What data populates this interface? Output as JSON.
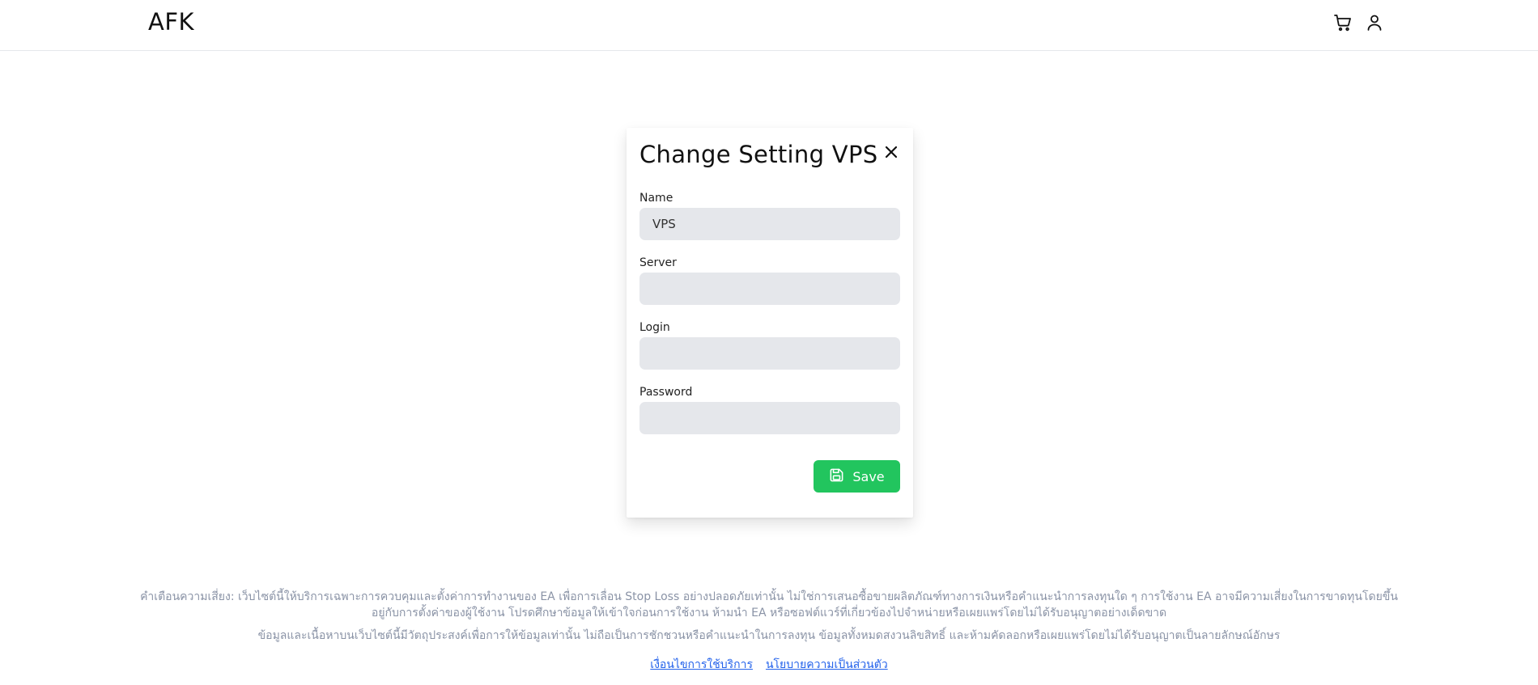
{
  "header": {
    "logo": "AFK",
    "cart_icon": "cart-icon",
    "user_icon": "user-icon"
  },
  "dialog": {
    "title": "Change Setting VPS",
    "close_icon": "close-icon",
    "fields": [
      {
        "label": "Name",
        "value": "VPS",
        "placeholder": ""
      },
      {
        "label": "Server",
        "value": "",
        "placeholder": ""
      },
      {
        "label": "Login",
        "value": "",
        "placeholder": ""
      },
      {
        "label": "Password",
        "value": "",
        "placeholder": ""
      }
    ],
    "save_label": "Save",
    "save_icon": "save-icon"
  },
  "footer": {
    "disclaimer": "คำเตือนความเสี่ยง: เว็บไซต์นี้ให้บริการเฉพาะการควบคุมและตั้งค่าการทำงานของ EA เพื่อการเลื่อน Stop Loss อย่างปลอดภัยเท่านั้น ไม่ใช่การเสนอซื้อขายผลิตภัณฑ์ทางการเงินหรือคำแนะนำการลงทุนใด ๆ การใช้งาน EA อาจมีความเสี่ยงในการขาดทุนโดยขึ้นอยู่กับการตั้งค่าของผู้ใช้งาน โปรดศึกษาข้อมูลให้เข้าใจก่อนการใช้งาน ห้ามนำ EA หรือซอฟต์แวร์ที่เกี่ยวข้องไปจำหน่ายหรือเผยแพร่โดยไม่ได้รับอนุญาตอย่างเด็ดขาด",
    "info": "ข้อมูลและเนื้อหาบนเว็บไซต์นี้มีวัตถุประสงค์เพื่อการให้ข้อมูลเท่านั้น ไม่ถือเป็นการชักชวนหรือคำแนะนำในการลงทุน ข้อมูลทั้งหมดสงวนลิขสิทธิ์ และห้ามคัดลอกหรือเผยแพร่โดยไม่ได้รับอนุญาตเป็นลายลักษณ์อักษร",
    "links": [
      "เงื่อนไขการใช้บริการ",
      "นโยบายความเป็นส่วนตัว"
    ]
  },
  "colors": {
    "accent_green": "#22c55e",
    "input_bg": "#e5e7eb",
    "footer_text": "#8a93a6",
    "link": "#2563eb"
  }
}
